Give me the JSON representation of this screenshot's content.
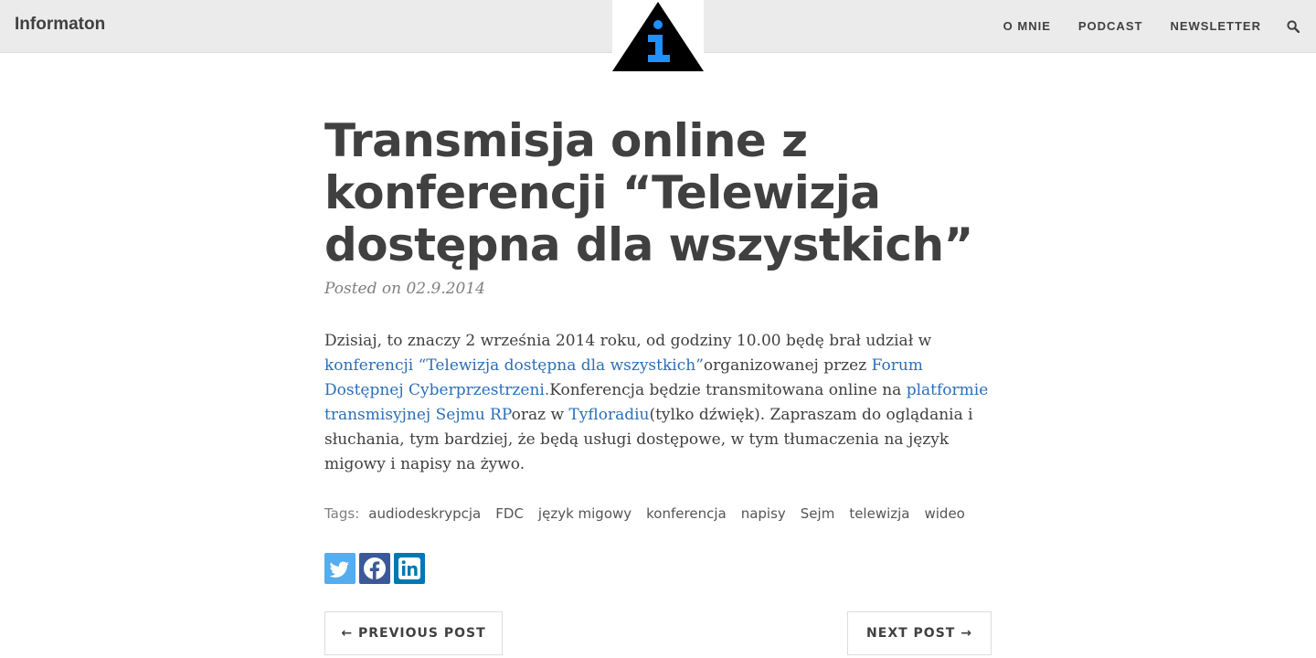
{
  "navbar": {
    "brand": "Informaton",
    "links": [
      "O MNIE",
      "PODCAST",
      "NEWSLETTER"
    ],
    "search_icon": "search-icon",
    "logo": {
      "glyph": "i",
      "triangle_color": "#000000",
      "glyph_color": "#1e90ff"
    }
  },
  "post": {
    "title": "Transmisja online z konferencji “Telewizja dostępna dla wszystkich”",
    "meta": "Posted on 02.9.2014",
    "body": {
      "t1": "Dzisiaj, to znaczy 2 września 2014 roku, od godziny 10.00 będę brał udział w ",
      "l1": "konferencji “Telewizja dostępna dla wszystkich”",
      "t2": "organizowanej przez ",
      "l2": "Forum Dostępnej Cyberprzestrzeni.",
      "t3": "Konferencja będzie transmitowana online na ",
      "l3": "platformie transmisyjnej Sejmu RP",
      "t4": "oraz w ",
      "l4": "Tyfloradiu",
      "t5": "(tylko dźwięk). Zapraszam do oglądania i słuchania, tym bardziej, że będą usługi dostępowe, w tym tłumaczenia na język migowy i napisy na żywo."
    },
    "tags_label": "Tags:",
    "tags": [
      "audiodeskrypcja",
      "FDC",
      "język migowy",
      "konferencja",
      "napisy",
      "Sejm",
      "telewizja",
      "wideo"
    ],
    "share": [
      {
        "icon": "twitter-icon",
        "color": "#55acee"
      },
      {
        "icon": "facebook-icon",
        "color": "#3b5998"
      },
      {
        "icon": "linkedin-icon",
        "color": "#0077b5"
      }
    ]
  },
  "pager": {
    "previous": "← PREVIOUS POST",
    "next": "NEXT POST →"
  },
  "colors": {
    "link": "#2b6fb8",
    "text": "#404040",
    "navbar_bg": "#ebebeb"
  }
}
